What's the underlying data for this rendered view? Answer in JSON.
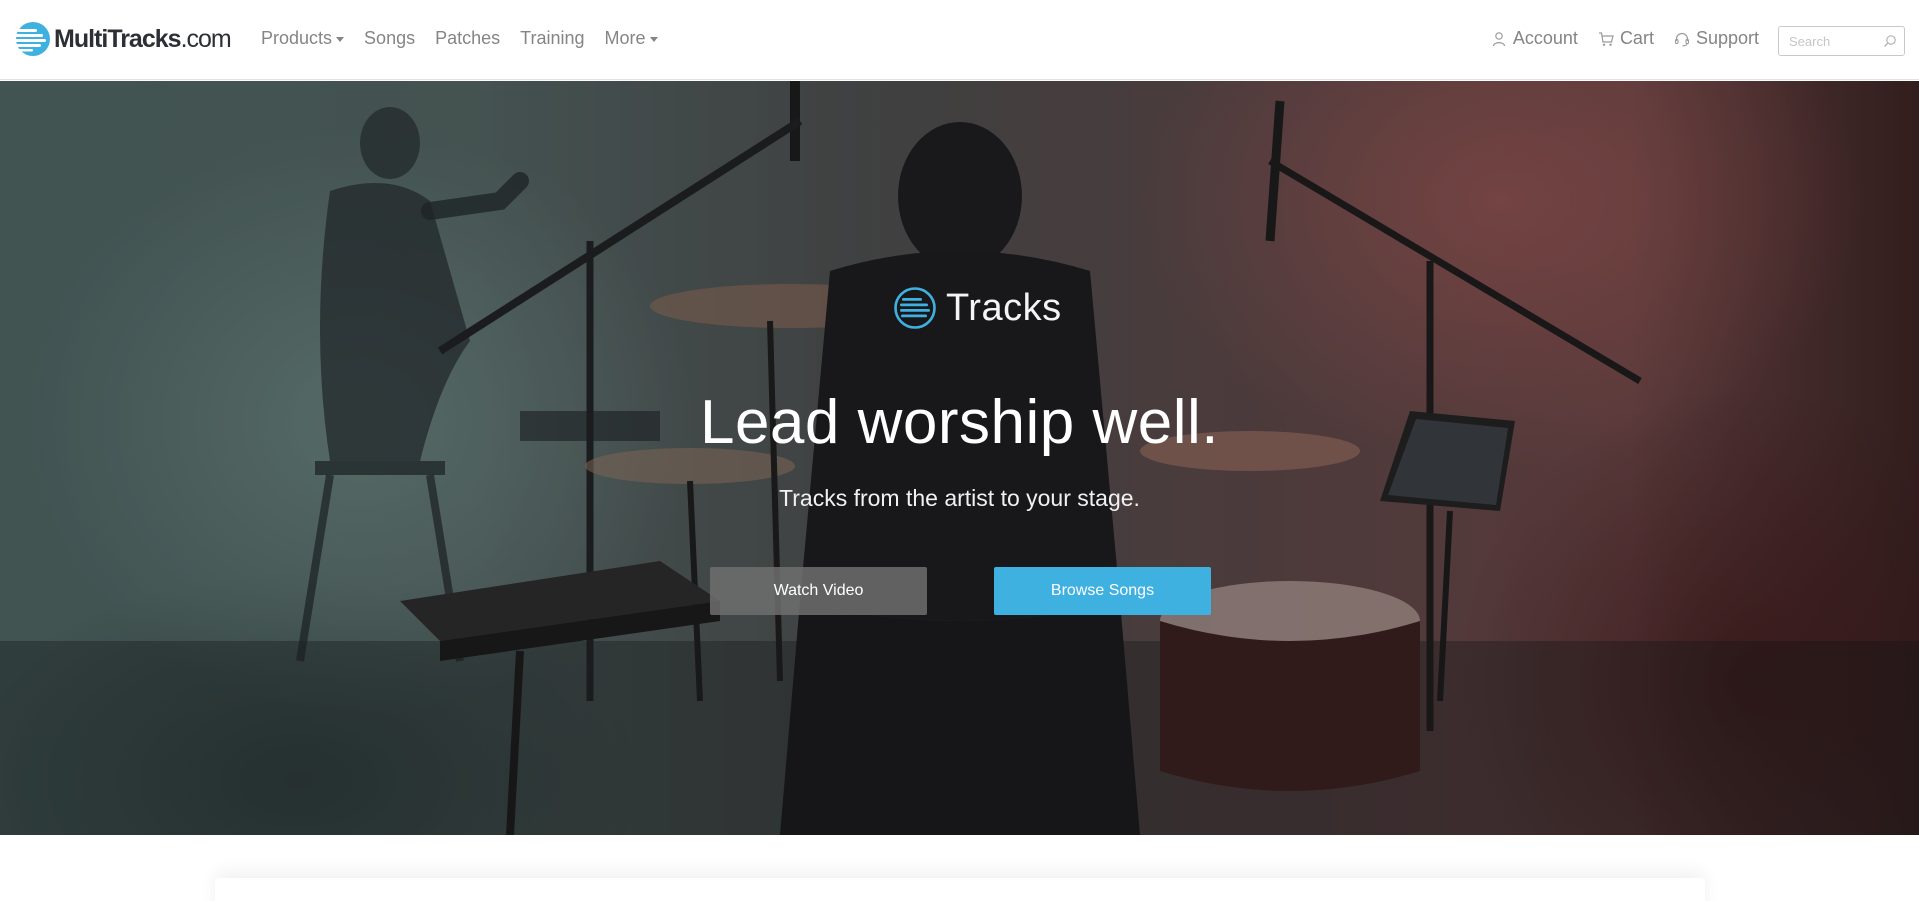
{
  "header": {
    "logo": {
      "name": "MultiTracks",
      "suffix": ".com"
    },
    "nav": [
      {
        "label": "Products",
        "has_dropdown": true
      },
      {
        "label": "Songs",
        "has_dropdown": false
      },
      {
        "label": "Patches",
        "has_dropdown": false
      },
      {
        "label": "Training",
        "has_dropdown": false
      },
      {
        "label": "More",
        "has_dropdown": true
      }
    ],
    "utility": [
      {
        "label": "Account",
        "icon": "user-icon"
      },
      {
        "label": "Cart",
        "icon": "cart-icon"
      },
      {
        "label": "Support",
        "icon": "headset-icon"
      }
    ],
    "search": {
      "placeholder": "Search",
      "value": ""
    }
  },
  "hero": {
    "brand": "Tracks",
    "headline": "Lead worship well.",
    "subhead": "Tracks from the artist to your stage.",
    "buttons": {
      "watch": "Watch Video",
      "browse": "Browse Songs"
    }
  },
  "colors": {
    "accent": "#3fb1e1",
    "nav_text": "#858585",
    "logo_text": "#2c2f33"
  }
}
